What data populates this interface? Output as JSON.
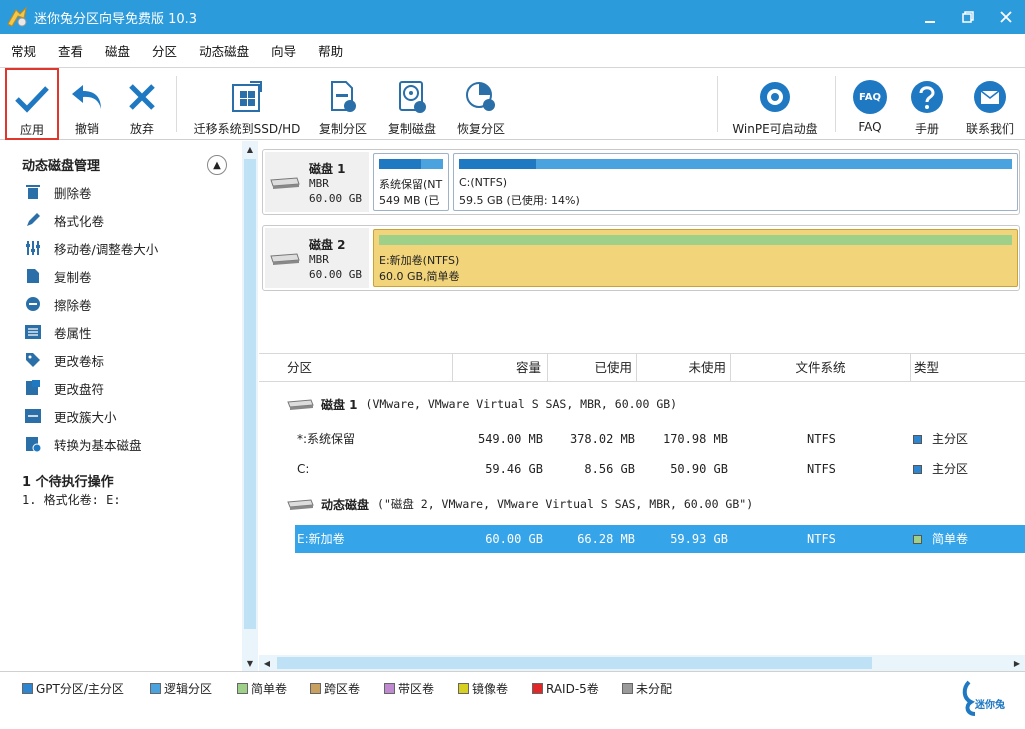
{
  "window": {
    "title": "迷你兔分区向导免费版 10.3"
  },
  "menu": [
    "常规",
    "查看",
    "磁盘",
    "分区",
    "动态磁盘",
    "向导",
    "帮助"
  ],
  "toolbar": {
    "apply": "应用",
    "undo": "撤销",
    "discard": "放弃",
    "migrate": "迁移系统到SSD/HD",
    "copy_partition": "复制分区",
    "copy_disk": "复制磁盘",
    "recover_partition": "恢复分区",
    "winpe": "WinPE可启动盘",
    "faq": "FAQ",
    "manual": "手册",
    "contact": "联系我们",
    "faq_icon_text": "FAQ"
  },
  "sidebar": {
    "heading": "动态磁盘管理",
    "items": [
      {
        "label": "删除卷",
        "icon": "trash-icon"
      },
      {
        "label": "格式化卷",
        "icon": "pencil-icon"
      },
      {
        "label": "移动卷/调整卷大小",
        "icon": "sliders-icon"
      },
      {
        "label": "复制卷",
        "icon": "copy-icon"
      },
      {
        "label": "擦除卷",
        "icon": "wipe-icon"
      },
      {
        "label": "卷属性",
        "icon": "properties-icon"
      },
      {
        "label": "更改卷标",
        "icon": "tag-icon"
      },
      {
        "label": "更改盘符",
        "icon": "drive-letter-icon"
      },
      {
        "label": "更改簇大小",
        "icon": "cluster-icon"
      },
      {
        "label": "转换为基本磁盘",
        "icon": "convert-icon"
      }
    ],
    "pending_title": "1 个待执行操作",
    "pending_items": [
      "1. 格式化卷: E:"
    ]
  },
  "disks": [
    {
      "name": "磁盘 1",
      "type": "MBR",
      "size": "60.00 GB",
      "partitions": [
        {
          "line1": "系统保留(NT",
          "line2": "549 MB (已"
        },
        {
          "line1": "C:(NTFS)",
          "line2": "59.5 GB (已使用: 14%)",
          "used_fraction": 0.14
        }
      ]
    },
    {
      "name": "磁盘 2",
      "type": "MBR",
      "size": "60.00 GB",
      "partitions": [
        {
          "line1": "E:新加卷(NTFS)",
          "line2": "60.0 GB,简单卷"
        }
      ]
    }
  ],
  "table": {
    "headers": [
      "分区",
      "容量",
      "已使用",
      "未使用",
      "文件系统",
      "类型"
    ],
    "groups": [
      {
        "title": "磁盘 1",
        "desc": "(VMware, VMware Virtual S SAS, MBR, 60.00 GB)",
        "rows": [
          {
            "name": "*:系统保留",
            "capacity": "549.00 MB",
            "used": "378.02 MB",
            "unused": "170.98 MB",
            "fs": "NTFS",
            "type": "主分区",
            "color": "#2e86d1"
          },
          {
            "name": "C:",
            "capacity": "59.46 GB",
            "used": "8.56 GB",
            "unused": "50.90 GB",
            "fs": "NTFS",
            "type": "主分区",
            "color": "#2e86d1"
          }
        ]
      },
      {
        "title": "动态磁盘",
        "desc": "(\"磁盘 2, VMware, VMware Virtual S SAS, MBR, 60.00 GB\")",
        "rows": [
          {
            "name": "E:新加卷",
            "capacity": "60.00 GB",
            "used": "66.28 MB",
            "unused": "59.93 GB",
            "fs": "NTFS",
            "type": "简单卷",
            "color": "#9fd08a",
            "selected": true
          }
        ]
      }
    ]
  },
  "legend": [
    {
      "label": "GPT分区/主分区",
      "color": "#2e86d1"
    },
    {
      "label": "逻辑分区",
      "color": "#4aa3df"
    },
    {
      "label": "简单卷",
      "color": "#9fd08a"
    },
    {
      "label": "跨区卷",
      "color": "#c8a060"
    },
    {
      "label": "带区卷",
      "color": "#c08ad0"
    },
    {
      "label": "镜像卷",
      "color": "#d8d020"
    },
    {
      "label": "RAID-5卷",
      "color": "#e02828"
    },
    {
      "label": "未分配",
      "color": "#9a9a9a"
    }
  ],
  "brand": {
    "text": "迷你兔"
  },
  "colors": {
    "accent": "#2b9bdc",
    "selected_row": "#35a4e8",
    "disk2_volume": "#f2d57a",
    "apply_highlight": "#e0362c"
  }
}
